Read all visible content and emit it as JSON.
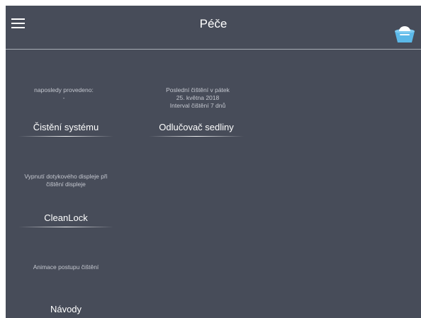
{
  "header": {
    "title": "Péče",
    "menu_icon": "hamburger-menu-icon",
    "device_icon": "washer-device-icon"
  },
  "items": [
    {
      "desc_lines": [
        "naposledy provedeno:",
        "-"
      ],
      "button_label": "Čistění systému"
    },
    {
      "desc_lines": [
        "Poslední čištění v pátek",
        "25. května 2018",
        "Interval čištění 7 dnů"
      ],
      "button_label": "Odlučovač sedliny"
    },
    {
      "desc_lines": [
        "Vypnutí dotykového displeje při",
        "čištění displeje"
      ],
      "button_label": "CleanLock"
    },
    {
      "desc_lines": [
        "Animace postupu čištění"
      ],
      "button_label": "Návody"
    }
  ],
  "colors": {
    "background": "#474c59",
    "text": "#ffffff",
    "secondary_text": "#c4c7cf",
    "device_icon": "#5bb8e8"
  }
}
